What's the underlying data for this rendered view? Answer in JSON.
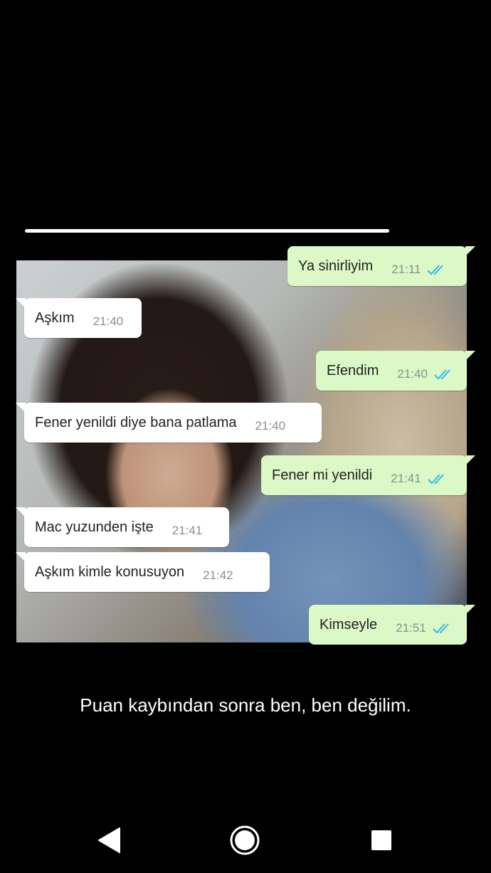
{
  "messages": [
    {
      "dir": "out",
      "text": "Ya sinirliyim",
      "time": "21:11"
    },
    {
      "dir": "in",
      "text": "Aşkım",
      "time": "21:40"
    },
    {
      "dir": "out",
      "text": "Efendim",
      "time": "21:40"
    },
    {
      "dir": "in",
      "text": "Fener yenildi diye bana patlama",
      "time": "21:40"
    },
    {
      "dir": "out",
      "text": "Fener mi yenildi",
      "time": "21:41"
    },
    {
      "dir": "in",
      "text": "Mac yuzunden işte",
      "time": "21:41"
    },
    {
      "dir": "in",
      "text": "Aşkım  kimle konusuyon",
      "time": "21:42"
    },
    {
      "dir": "out",
      "text": "Kimseyle",
      "time": "21:51"
    }
  ],
  "caption": "Puan kaybından sonra ben, ben değilim.",
  "colors": {
    "incoming": "#ffffff",
    "outgoing": "#dcf8c6",
    "read_ticks": "#34b7f1"
  }
}
